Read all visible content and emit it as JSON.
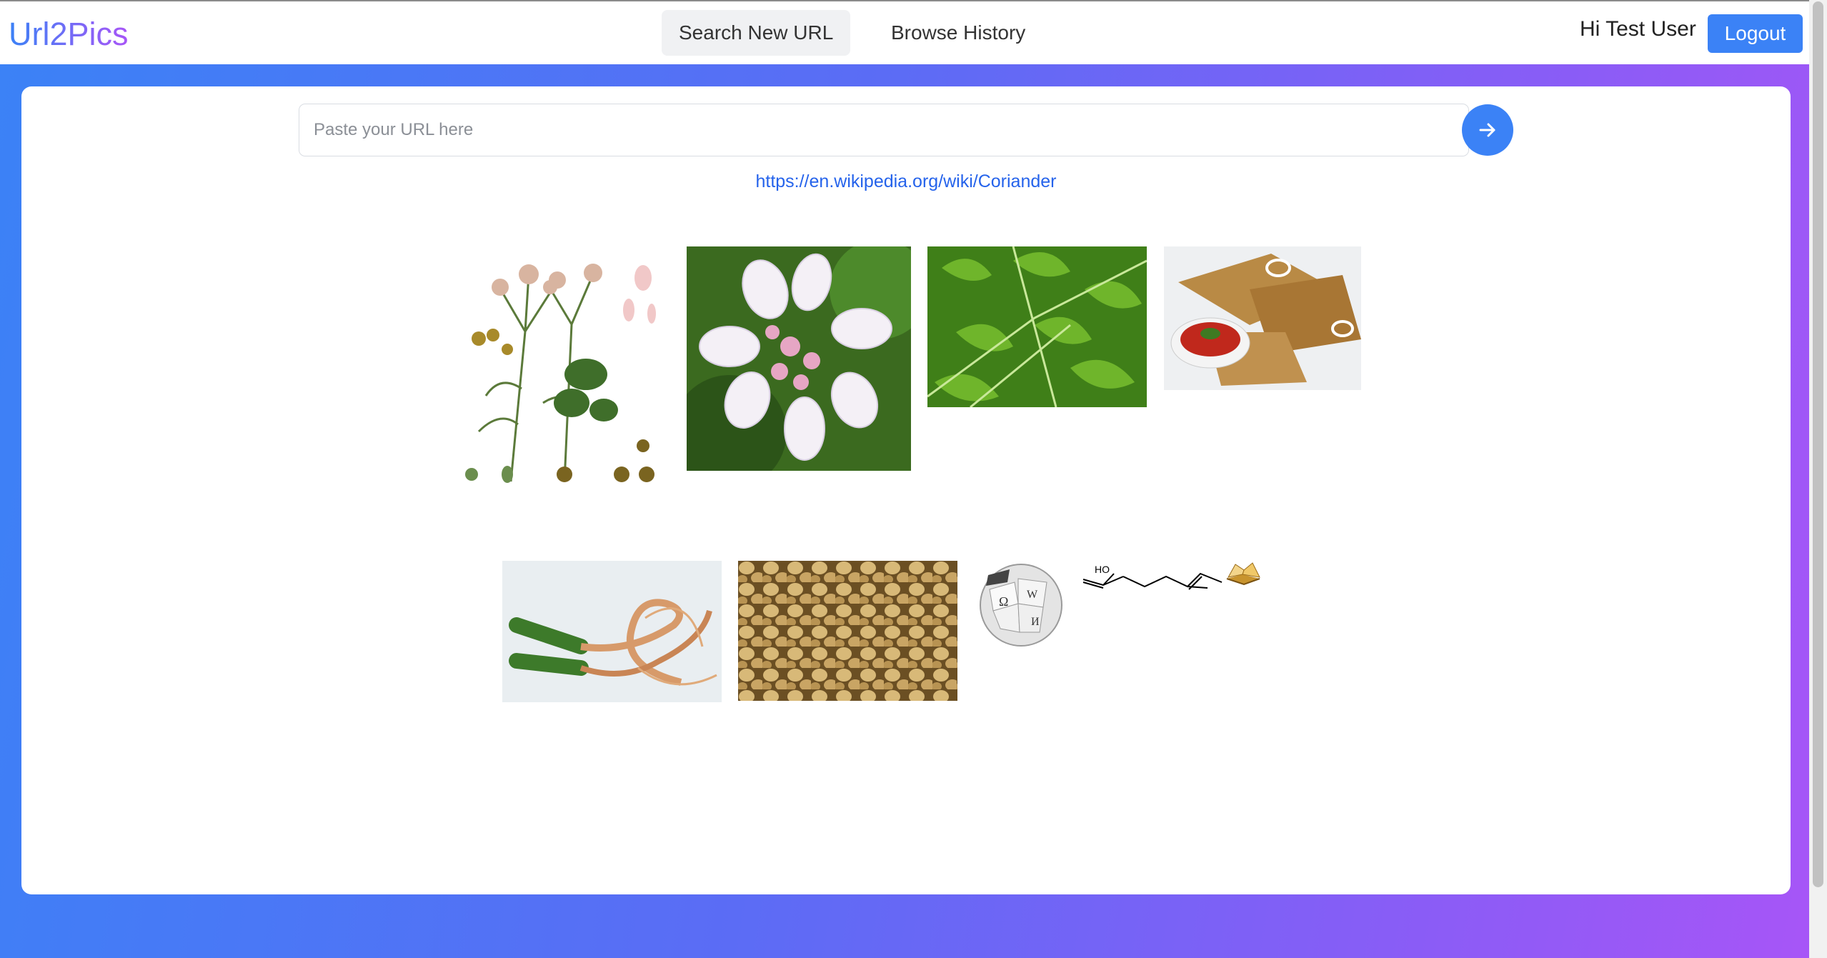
{
  "brand": {
    "name": "Url2Pics"
  },
  "nav": {
    "search_label": "Search New URL",
    "history_label": "Browse History"
  },
  "user": {
    "greeting": "Hi Test User",
    "logout_label": "Logout"
  },
  "search": {
    "placeholder": "Paste your URL here",
    "value": "",
    "submit_icon": "arrow-right-icon"
  },
  "result": {
    "url": "https://en.wikipedia.org/wiki/Coriander"
  },
  "images": [
    {
      "subject": "coriander botanical illustration"
    },
    {
      "subject": "coriander flower"
    },
    {
      "subject": "coriander leaves"
    },
    {
      "subject": "flatbread with chutney"
    },
    {
      "subject": "coriander roots"
    },
    {
      "subject": "coriander seeds"
    },
    {
      "subject": "wikipedia globe logo"
    },
    {
      "subject": "linalool chemical structure"
    },
    {
      "subject": "book icon"
    }
  ],
  "colors": {
    "accent": "#3b82f6",
    "gradient_start": "#3b82f6",
    "gradient_end": "#a855f7",
    "link": "#2563eb"
  }
}
